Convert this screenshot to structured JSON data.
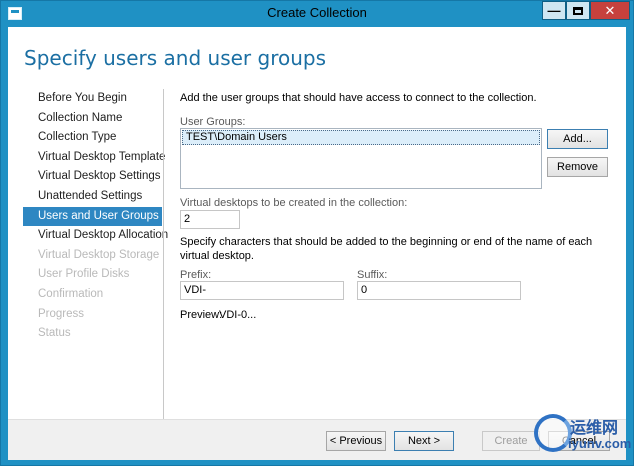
{
  "window": {
    "title": "Create Collection"
  },
  "page": {
    "title": "Specify users and user groups"
  },
  "nav": {
    "items": [
      {
        "label": "Before You Begin",
        "state": "done"
      },
      {
        "label": "Collection Name",
        "state": "done"
      },
      {
        "label": "Collection Type",
        "state": "done"
      },
      {
        "label": "Virtual Desktop Template",
        "state": "done"
      },
      {
        "label": "Virtual Desktop Settings",
        "state": "done"
      },
      {
        "label": "Unattended Settings",
        "state": "done"
      },
      {
        "label": "Users and User Groups",
        "state": "active"
      },
      {
        "label": "Virtual Desktop Allocation",
        "state": "done"
      },
      {
        "label": "Virtual Desktop Storage",
        "state": "disabled"
      },
      {
        "label": "User Profile Disks",
        "state": "disabled"
      },
      {
        "label": "Confirmation",
        "state": "disabled"
      },
      {
        "label": "Progress",
        "state": "disabled"
      },
      {
        "label": "Status",
        "state": "disabled"
      }
    ]
  },
  "main": {
    "instruction": "Add the user groups that should have access to connect to the collection.",
    "user_groups_label": "User Groups:",
    "user_groups": [
      "TEST\\Domain Users"
    ],
    "add_button": "Add...",
    "remove_button": "Remove",
    "desktops_label": "Virtual desktops to be created in the collection:",
    "desktops_value": "2",
    "naming_instruction": "Specify characters that should be added to the beginning or end of the name of each virtual desktop.",
    "prefix_label": "Prefix:",
    "prefix_value": "VDI-",
    "suffix_label": "Suffix:",
    "suffix_value": "0",
    "preview_label": "Preview:",
    "preview_value": "VDI-0..."
  },
  "footer": {
    "previous_button": "< Previous",
    "next_button": "Next >",
    "create_button": "Create",
    "cancel_button": "Cancel"
  },
  "watermark": {
    "line1": "运维网",
    "line2": "iyunv.com"
  },
  "colors": {
    "accent": "#1f91c4",
    "nav_active": "#2e87c2",
    "title_text": "#1b6fa3"
  }
}
